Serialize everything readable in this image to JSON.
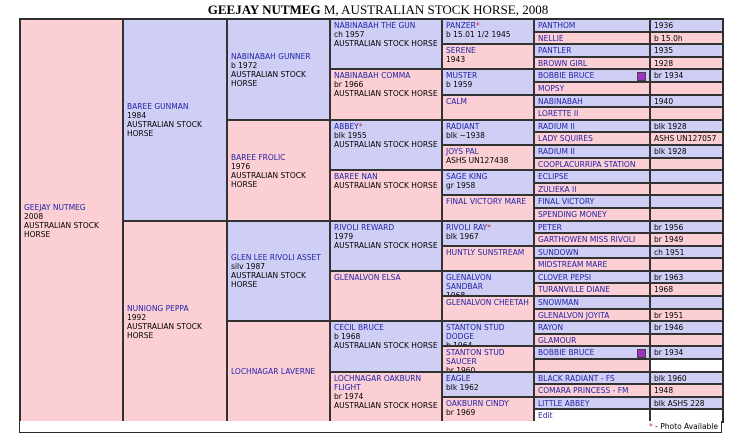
{
  "title": {
    "name": "GEEJAY NUTMEG",
    "rest": " M, AUSTRALIAN STOCK HORSE, 2008"
  },
  "g1": {
    "name": "GEEJAY NUTMEG",
    "l1": "2008",
    "l2": "AUSTRALIAN STOCK HORSE"
  },
  "g2": [
    {
      "name": "BAREE GUNMAN",
      "l1": "1984",
      "l2": "AUSTRALIAN STOCK HORSE"
    },
    {
      "name": "NUNIONG PEPPA",
      "l1": "1992",
      "l2": "AUSTRALIAN STOCK HORSE"
    }
  ],
  "g3": [
    {
      "name": "NABINABAH GUNNER",
      "l1": "b 1972",
      "l2": "AUSTRALIAN STOCK HORSE"
    },
    {
      "name": "BAREE FROLIC",
      "l1": "1976",
      "l2": "AUSTRALIAN STOCK HORSE"
    },
    {
      "name": "GLEN LEE RIVOLI ASSET",
      "l1": "silv 1987",
      "l2": "AUSTRALIAN STOCK HORSE"
    },
    {
      "name": "LOCHNAGAR LAVERNE",
      "l1": "",
      "l2": ""
    }
  ],
  "g4": [
    {
      "name": "NABINABAH THE GUN",
      "l1": "ch 1957",
      "l2": "AUSTRALIAN STOCK HORSE"
    },
    {
      "name": "NABINABAH COMMA",
      "l1": "br 1966",
      "l2": "AUSTRALIAN STOCK HORSE"
    },
    {
      "name": "ABBEY",
      "star": "*",
      "l1": "blk 1955",
      "l2": "AUSTRALIAN STOCK HORSE"
    },
    {
      "name": "BAREE NAN",
      "l1": "",
      "l2": "AUSTRALIAN STOCK HORSE"
    },
    {
      "name": "RIVOLI REWARD",
      "l1": "1979",
      "l2": "AUSTRALIAN STOCK HORSE"
    },
    {
      "name": "GLENALVON ELSA",
      "l1": "",
      "l2": ""
    },
    {
      "name": "CECIL BRUCE",
      "l1": "b 1968",
      "l2": "AUSTRALIAN STOCK HORSE"
    },
    {
      "name": "LOCHNAGAR OAKBURN FLIGHT",
      "l1": "br 1974",
      "l2": "AUSTRALIAN STOCK HORSE"
    }
  ],
  "g5": [
    {
      "name": "PANZER",
      "star": "*",
      "l1": "b 15.01 1/2 1945"
    },
    {
      "name": "SERENE",
      "l1": "1943"
    },
    {
      "name": "MUSTER",
      "l1": "b 1959"
    },
    {
      "name": "CALM",
      "l1": ""
    },
    {
      "name": "RADIANT",
      "l1": "blk ~1938"
    },
    {
      "name": "JOYS PAL",
      "l1": "ASHS UN127438"
    },
    {
      "name": "SAGE KING",
      "l1": "gr 1958"
    },
    {
      "name": "FINAL VICTORY MARE",
      "l1": ""
    },
    {
      "name": "RIVOLI RAY",
      "star": "*",
      "l1": "blk 1967"
    },
    {
      "name": "HUNTLY SUNSTREAM",
      "l1": ""
    },
    {
      "name": "GLENALVON SANDBAR",
      "l1": "1968"
    },
    {
      "name": "GLENALVON CHEETAH",
      "l1": ""
    },
    {
      "name": "STANTON STUD DODGE",
      "l1": "b 1964"
    },
    {
      "name": "STANTON STUD SAUCER",
      "l1": "br 1960"
    },
    {
      "name": "EAGLE",
      "l1": "blk 1962"
    },
    {
      "name": "OAKBURN CINDY",
      "l1": "br 1969"
    }
  ],
  "g6": [
    {
      "name": "PANTHOM",
      "info": "1936"
    },
    {
      "name": "NELLIE",
      "info": "b 15.0h"
    },
    {
      "name": "PANTLER",
      "info": "1935"
    },
    {
      "name": "BROWN GIRL",
      "info": "1928"
    },
    {
      "name": "BOBBIE BRUCE",
      "info": "br 1934",
      "swatch": true
    },
    {
      "name": "MOPSY",
      "info": ""
    },
    {
      "name": "NABINABAH",
      "info": "1940"
    },
    {
      "name": "LORETTE II",
      "info": ""
    },
    {
      "name": "RADIUM II",
      "info": "blk 1928"
    },
    {
      "name": "LADY SQUIRES",
      "info": "ASHS UN127057"
    },
    {
      "name": "RADIUM II",
      "info": "blk 1928"
    },
    {
      "name": "COOPLACURRIPA STATION MARE",
      "info": ""
    },
    {
      "name": "ECLIPSE",
      "info": ""
    },
    {
      "name": "ZULIEKA II",
      "info": ""
    },
    {
      "name": "FINAL VICTORY",
      "info": ""
    },
    {
      "name": "SPENDING MONEY",
      "info": ""
    },
    {
      "name": "PETER",
      "info": "br 1956"
    },
    {
      "name": "GARTHOWEN MISS RIVOLI",
      "info": "br 1949"
    },
    {
      "name": "SUNDOWN",
      "info": "ch 1951"
    },
    {
      "name": "MIDSTREAM MARE",
      "info": ""
    },
    {
      "name": "CLOVER PEPSI",
      "info": "br 1963"
    },
    {
      "name": "TURANVILLE DIANE",
      "info": "1968"
    },
    {
      "name": "SNOWMAN",
      "info": ""
    },
    {
      "name": "GLENALVON JOYITA",
      "info": "br 1951"
    },
    {
      "name": "RAYON",
      "info": "br 1946"
    },
    {
      "name": "GLAMOUR",
      "info": ""
    },
    {
      "name": "BOBBIE BRUCE",
      "info": "br 1934",
      "swatch": true
    },
    {
      "name": "",
      "info": ""
    },
    {
      "name": "BLACK RADIANT - FS",
      "info": "blk 1960"
    },
    {
      "name": "COMARA PRINCESS - FM",
      "info": "1948"
    },
    {
      "name": "LITTLE ABBEY",
      "info": "blk ASHS 228 1965"
    },
    {
      "name": "",
      "info": ""
    }
  ],
  "edit_label": "Edit",
  "footer": {
    "star": "*",
    "text": " - Photo Available"
  }
}
